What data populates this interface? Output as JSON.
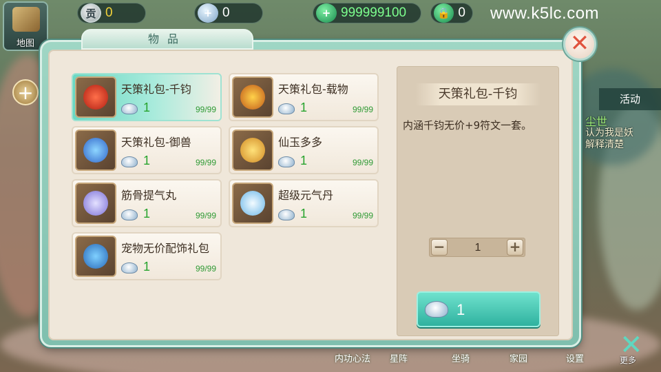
{
  "topbar": {
    "gong_icon_text": "贡",
    "gong_value": "0",
    "silver_value": "0",
    "jade_value": "999999100",
    "jade_locked_value": "0",
    "watermark": "www.k5lc.com"
  },
  "sidebar": {
    "map_label": "地图"
  },
  "panel": {
    "title": "物品",
    "close_symbol": "✕"
  },
  "items": [
    {
      "name": "天策礼包-千钧",
      "price": "1",
      "stock": "99/99",
      "selected": true
    },
    {
      "name": "天策礼包-载物",
      "price": "1",
      "stock": "99/99",
      "selected": false
    },
    {
      "name": "天策礼包-御兽",
      "price": "1",
      "stock": "99/99",
      "selected": false
    },
    {
      "name": "仙玉多多",
      "price": "1",
      "stock": "99/99",
      "selected": false
    },
    {
      "name": "筋骨提气丸",
      "price": "1",
      "stock": "99/99",
      "selected": false
    },
    {
      "name": "超级元气丹",
      "price": "1",
      "stock": "99/99",
      "selected": false
    },
    {
      "name": "宠物无价配饰礼包",
      "price": "1",
      "stock": "99/99",
      "selected": false
    }
  ],
  "detail": {
    "title": "天策礼包-千钧",
    "description": "内涵千钧无价+9符文一套。",
    "quantity": "1",
    "minus": "−",
    "plus": "+",
    "buy_price": "1"
  },
  "right_side": {
    "activity_label": "活动",
    "side_title": "尘世",
    "side_line1": "认为我是妖",
    "side_line2": "解释清楚"
  },
  "bottom_bar": {
    "labels": [
      "内功心法",
      "星阵",
      "坐骑",
      "家园",
      "设置"
    ],
    "more_label": "更多"
  },
  "colors": {
    "panel_teal": "#7fbfae",
    "price_green": "#27a32d",
    "jade_green": "#7dff8e",
    "gold": "#f2d23a",
    "close_red": "#e0543f"
  }
}
